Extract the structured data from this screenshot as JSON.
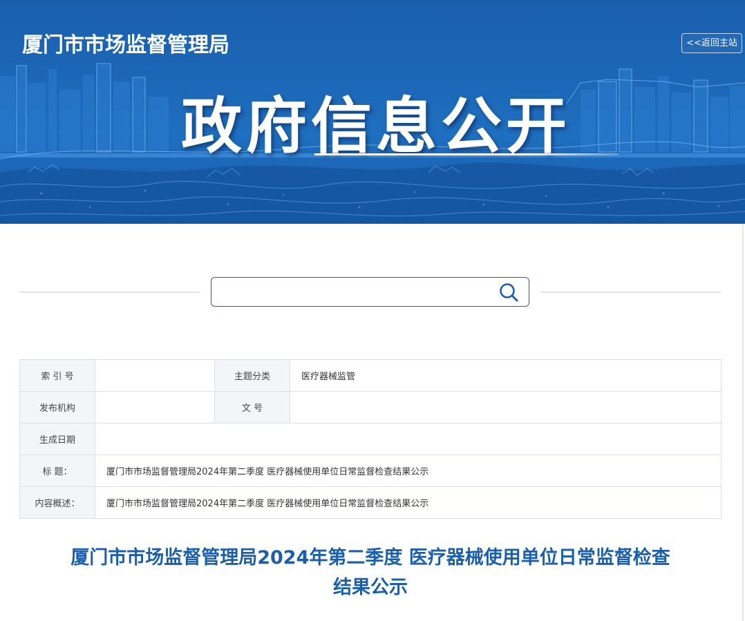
{
  "header": {
    "site_name": "厦门市市场监督管理局",
    "back_link": "<<返回主站",
    "banner_title": "政府信息公开"
  },
  "search": {
    "placeholder": "",
    "icon": "search-icon"
  },
  "info_table": {
    "index_label": "索 引 号",
    "index_value": "",
    "topic_label": "主题分类",
    "topic_value": "医疗器械监管",
    "publisher_label": "发布机构",
    "publisher_value": "",
    "doc_no_label": "文 号",
    "doc_no_value": "",
    "date_label": "生成日期",
    "date_value": "",
    "title_label": "标 题：",
    "title_value": "厦门市市场监督管理局2024年第二季度 医疗器械使用单位日常监督检查结果公示",
    "summary_label": "内容概述：",
    "summary_value": "厦门市市场监督管理局2024年第二季度 医疗器械使用单位日常监督检查结果公示"
  },
  "article": {
    "title_line1": "厦门市市场监督管理局2024年第二季度 医疗器械使用单位日常监督检查",
    "title_line2": "结果公示"
  },
  "colors": {
    "brand_blue": "#1a5fae",
    "banner_blue": "#1d68b8",
    "table_key_bg": "#f4f5f7",
    "table_border": "#dcdfe4"
  }
}
